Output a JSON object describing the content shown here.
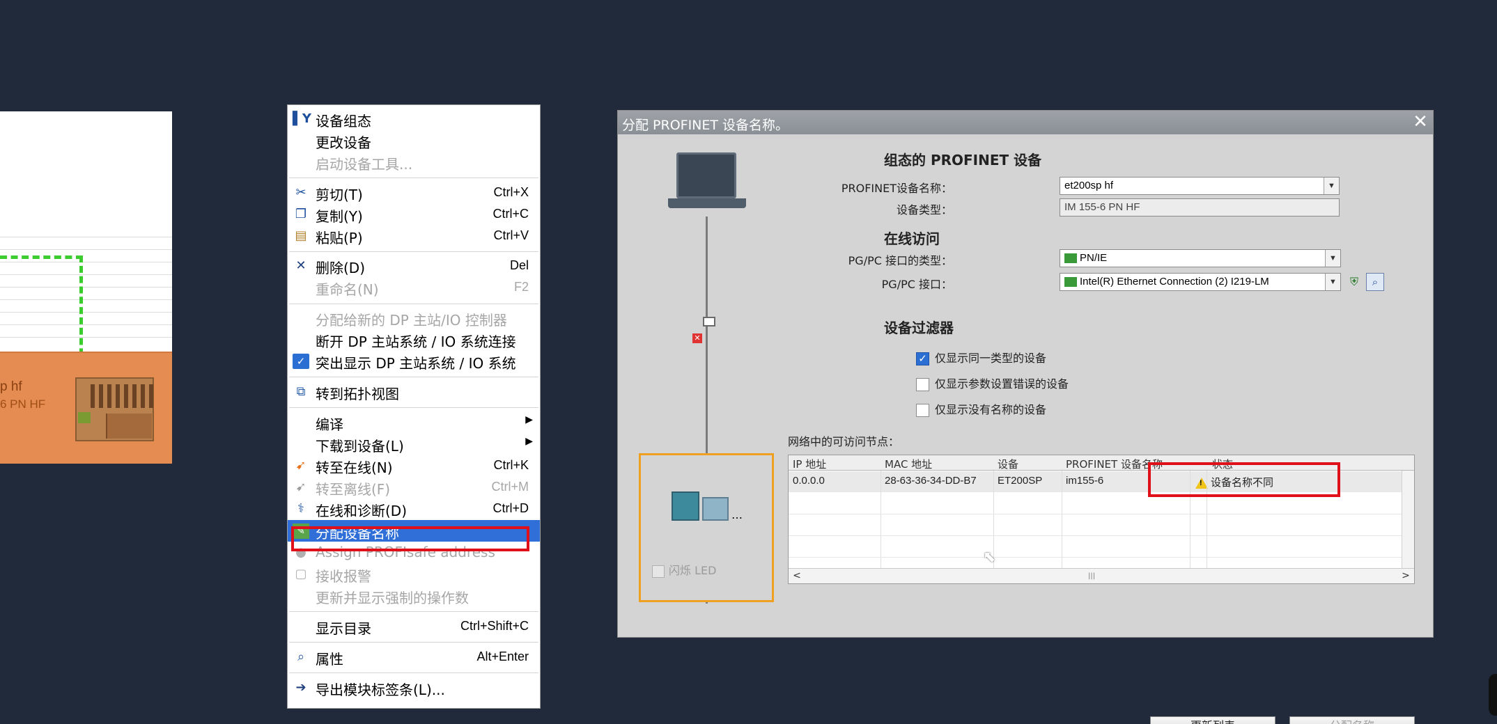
{
  "device_view": {
    "device_name": "p hf",
    "device_type": "6 PN HF"
  },
  "context_menu": {
    "items": [
      {
        "label": "设备组态",
        "shortcut": "",
        "icon": "device-config-icon",
        "disabled": false
      },
      {
        "label": "更改设备",
        "shortcut": "",
        "icon": "",
        "disabled": false
      },
      {
        "label": "启动设备工具...",
        "shortcut": "",
        "icon": "",
        "disabled": true
      },
      {
        "label": "剪切(T)",
        "shortcut": "Ctrl+X",
        "icon": "scissors-icon",
        "disabled": false
      },
      {
        "label": "复制(Y)",
        "shortcut": "Ctrl+C",
        "icon": "copy-icon",
        "disabled": false
      },
      {
        "label": "粘贴(P)",
        "shortcut": "Ctrl+V",
        "icon": "paste-icon",
        "disabled": false
      },
      {
        "label": "删除(D)",
        "shortcut": "Del",
        "icon": "delete-icon",
        "disabled": false
      },
      {
        "label": "重命名(N)",
        "shortcut": "F2",
        "icon": "",
        "disabled": true
      },
      {
        "label": "分配给新的 DP 主站/IO 控制器",
        "shortcut": "",
        "icon": "",
        "disabled": true
      },
      {
        "label": "断开 DP 主站系统 / IO 系统连接",
        "shortcut": "",
        "icon": "",
        "disabled": false
      },
      {
        "label": "突出显示 DP 主站系统 / IO 系统",
        "shortcut": "",
        "icon": "checkbox-checked-icon",
        "disabled": false
      },
      {
        "label": "转到拓扑视图",
        "shortcut": "",
        "icon": "topology-icon",
        "disabled": false
      },
      {
        "label": "编译",
        "shortcut": "",
        "icon": "",
        "disabled": false,
        "submenu": true
      },
      {
        "label": "下载到设备(L)",
        "shortcut": "",
        "icon": "",
        "disabled": false,
        "submenu": true
      },
      {
        "label": "转至在线(N)",
        "shortcut": "Ctrl+K",
        "icon": "go-online-icon",
        "disabled": false
      },
      {
        "label": "转至离线(F)",
        "shortcut": "Ctrl+M",
        "icon": "go-offline-icon",
        "disabled": true
      },
      {
        "label": "在线和诊断(D)",
        "shortcut": "Ctrl+D",
        "icon": "diagnostics-icon",
        "disabled": false
      },
      {
        "label": "分配设备名称",
        "shortcut": "",
        "icon": "assign-name-icon",
        "disabled": false,
        "highlighted": true
      },
      {
        "label": "Assign PROFIsafe address",
        "shortcut": "",
        "icon": "profisafe-icon",
        "disabled": true
      },
      {
        "label": "接收报警",
        "shortcut": "",
        "icon": "alarm-icon",
        "disabled": true
      },
      {
        "label": "更新并显示强制的操作数",
        "shortcut": "",
        "icon": "",
        "disabled": true
      },
      {
        "label": "显示目录",
        "shortcut": "Ctrl+Shift+C",
        "icon": "",
        "disabled": false
      },
      {
        "label": "属性",
        "shortcut": "Alt+Enter",
        "icon": "properties-icon",
        "disabled": false
      },
      {
        "label": "导出模块标签条(L)...",
        "shortcut": "",
        "icon": "export-icon",
        "disabled": false
      }
    ]
  },
  "dialog": {
    "title": "分配 PROFINET 设备名称。",
    "close_label": "✕",
    "configured": {
      "heading": "组态的 PROFINET 设备",
      "name_label": "PROFINET设备名称：",
      "name_value": "et200sp hf",
      "type_label": "设备类型：",
      "type_value": "IM 155-6 PN HF"
    },
    "online": {
      "heading": "在线访问",
      "pgpc_type_label": "PG/PC 接口的类型：",
      "pgpc_type_value": "PN/IE",
      "pgpc_if_label": "PG/PC 接口：",
      "pgpc_if_value": "Intel(R) Ethernet Connection (2) I219-LM"
    },
    "filter": {
      "heading": "设备过滤器",
      "options": [
        {
          "label": "仅显示同一类型的设备",
          "checked": true
        },
        {
          "label": "仅显示参数设置错误的设备",
          "checked": false
        },
        {
          "label": "仅显示没有名称的设备",
          "checked": false
        }
      ]
    },
    "nodes": {
      "label": "网络中的可访问节点：",
      "columns": [
        "IP 地址",
        "MAC 地址",
        "设备",
        "PROFINET 设备名称",
        "状态"
      ],
      "rows": [
        {
          "ip": "0.0.0.0",
          "mac": "28-63-36-34-DD-B7",
          "device": "ET200SP",
          "name": "im155-6",
          "status": "设备名称不同"
        }
      ]
    },
    "flash_led_label": "闪烁 LED",
    "buttons": {
      "refresh": "更新列表",
      "assign": "分配名称"
    }
  }
}
